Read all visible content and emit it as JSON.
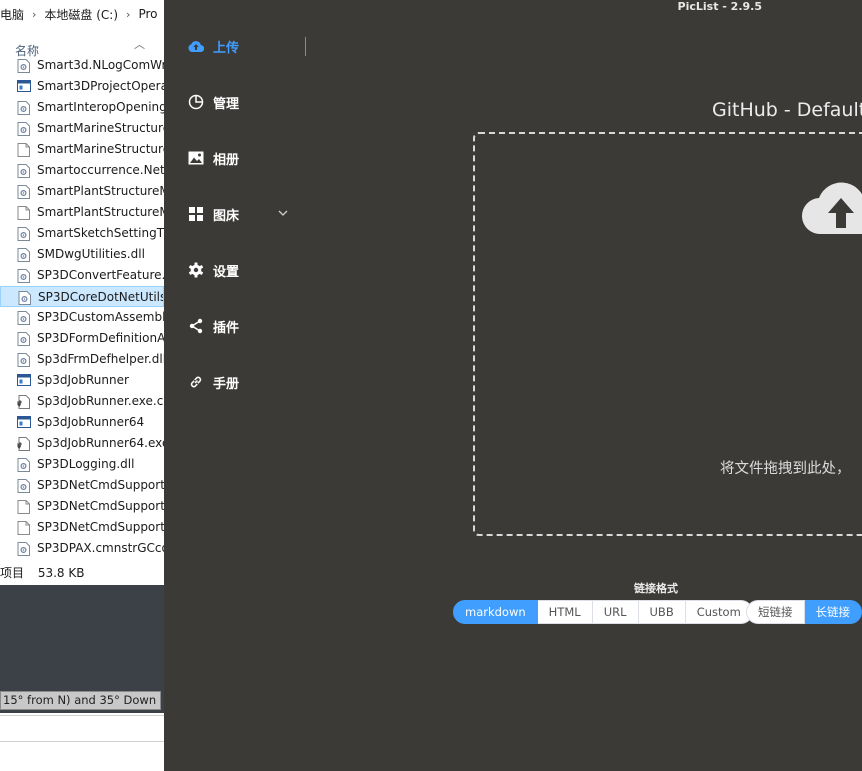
{
  "explorer": {
    "breadcrumb": [
      "电脑",
      "本地磁盘 (C:)",
      "Pro"
    ],
    "column_header": "名称",
    "files": [
      {
        "name": "Smart3d.NLogComWr",
        "icon": "dll-file-icon"
      },
      {
        "name": "Smart3DProjectOpera",
        "icon": "exe-file-icon"
      },
      {
        "name": "SmartInteropOpening",
        "icon": "dll-file-icon"
      },
      {
        "name": "SmartMarineStructure",
        "icon": "dll-file-icon"
      },
      {
        "name": "SmartMarineStructure",
        "icon": "blank-file-icon"
      },
      {
        "name": "Smartoccurrence.Net.d",
        "icon": "dll-file-icon"
      },
      {
        "name": "SmartPlantStructureM",
        "icon": "dll-file-icon"
      },
      {
        "name": "SmartPlantStructureM",
        "icon": "blank-file-icon"
      },
      {
        "name": "SmartSketchSettingTlb",
        "icon": "dll-file-icon"
      },
      {
        "name": "SMDwgUtilities.dll",
        "icon": "dll-file-icon"
      },
      {
        "name": "SP3DConvertFeature.d",
        "icon": "dll-file-icon"
      },
      {
        "name": "SP3DCoreDotNetUtils.",
        "icon": "dll-file-icon",
        "selected": true
      },
      {
        "name": "SP3DCustomAssembly",
        "icon": "dll-file-icon"
      },
      {
        "name": "SP3DFormDefinitionAc",
        "icon": "dll-file-icon"
      },
      {
        "name": "Sp3dFrmDefhelper.dll",
        "icon": "dll-file-icon"
      },
      {
        "name": "Sp3dJobRunner",
        "icon": "exe-file-icon"
      },
      {
        "name": "Sp3dJobRunner.exe.co",
        "icon": "config-file-icon"
      },
      {
        "name": "Sp3dJobRunner64",
        "icon": "exe-file-icon"
      },
      {
        "name": "Sp3dJobRunner64.exe",
        "icon": "config-file-icon"
      },
      {
        "name": "SP3DLogging.dll",
        "icon": "dll-file-icon"
      },
      {
        "name": "SP3DNetCmdSupport.",
        "icon": "dll-file-icon"
      },
      {
        "name": "SP3DNetCmdSupport.",
        "icon": "blank-file-icon"
      },
      {
        "name": "SP3DNetCmdSupport.",
        "icon": "blank-file-icon"
      },
      {
        "name": "SP3DPAX.cmnstrGCco",
        "icon": "dll-file-icon"
      }
    ],
    "status_items": "项目",
    "status_size": "53.8 KB",
    "tooltip": "15° from N) and 35° Down"
  },
  "app": {
    "title": "PicList - 2.9.5",
    "nav": [
      {
        "label": "上传",
        "icon": "cloud-upload-icon",
        "active": true
      },
      {
        "label": "管理",
        "icon": "pie-chart-icon"
      },
      {
        "label": "相册",
        "icon": "picture-icon"
      },
      {
        "label": "图床",
        "icon": "grid-icon",
        "has_submenu": true
      },
      {
        "label": "设置",
        "icon": "gear-icon"
      },
      {
        "label": "插件",
        "icon": "share-icon"
      },
      {
        "label": "手册",
        "icon": "link-icon"
      }
    ],
    "picbed_title": "GitHub - Default",
    "drop_text": "将文件拖拽到此处，",
    "link_format_label": "链接格式",
    "formats": [
      "markdown",
      "HTML",
      "URL",
      "UBB",
      "Custom"
    ],
    "selected_format": "markdown",
    "link_length": [
      "短链接",
      "长链接"
    ],
    "selected_length": "长链接",
    "accent_color": "#409eff"
  }
}
